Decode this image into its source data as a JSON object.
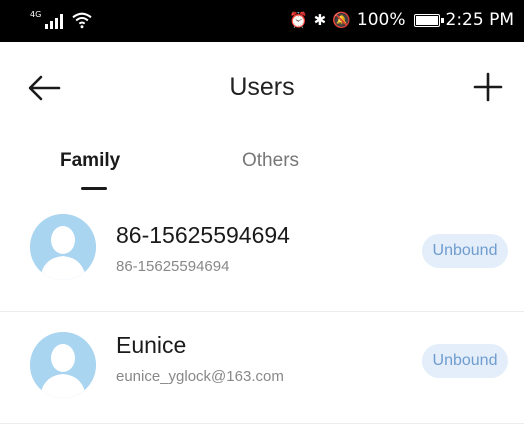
{
  "status_bar": {
    "network": "4G",
    "battery_percent": "100%",
    "time": "2:25 PM"
  },
  "header": {
    "title": "Users"
  },
  "tabs": [
    {
      "label": "Family",
      "active": true
    },
    {
      "label": "Others",
      "active": false
    }
  ],
  "users": [
    {
      "name": "86-15625594694",
      "subtitle": "86-15625594694",
      "status": "Unbound"
    },
    {
      "name": "Eunice",
      "subtitle": "eunice_yglock@163.com",
      "status": "Unbound"
    }
  ],
  "colors": {
    "avatar_bg": "#a9d5f1",
    "badge_bg": "#e3eefa",
    "badge_text": "#6f9ccf"
  }
}
